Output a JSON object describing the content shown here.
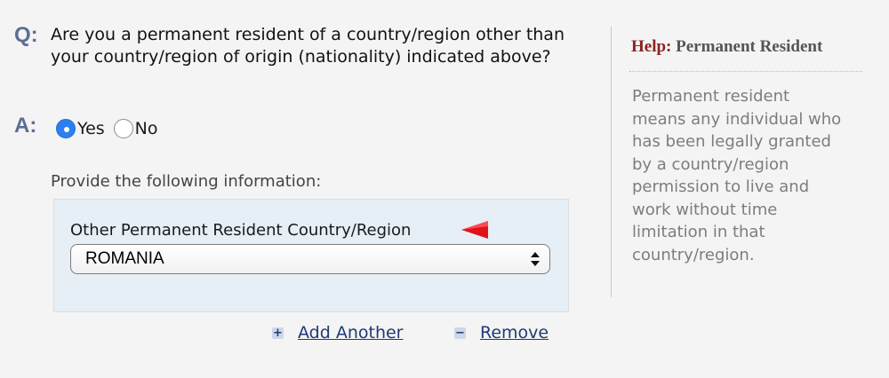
{
  "question": {
    "prefix": "Q:",
    "text": "Are you a permanent resident of a country/region other than your country/region of origin (nationality) indicated above?"
  },
  "answer": {
    "prefix": "A:",
    "options": [
      {
        "label": "Yes",
        "selected": true
      },
      {
        "label": "No",
        "selected": false
      }
    ]
  },
  "details": {
    "instruction": "Provide the following information:",
    "field_label": "Other Permanent Resident Country/Region",
    "select_value": "ROMANIA",
    "required_flag_color": "#e0121c"
  },
  "actions": {
    "add_icon": "+",
    "add_label": "Add Another",
    "remove_icon": "−",
    "remove_label": "Remove"
  },
  "help": {
    "title_prefix": "Help:",
    "title": "Permanent Resident",
    "body": "Permanent resident means any individual who has been legally granted by a country/region permission to live and work without time limitation in that country/region."
  },
  "colors": {
    "accent_link": "#1f3a75",
    "radio_selected": "#2d7ff0",
    "help_title": "#8a2323"
  }
}
